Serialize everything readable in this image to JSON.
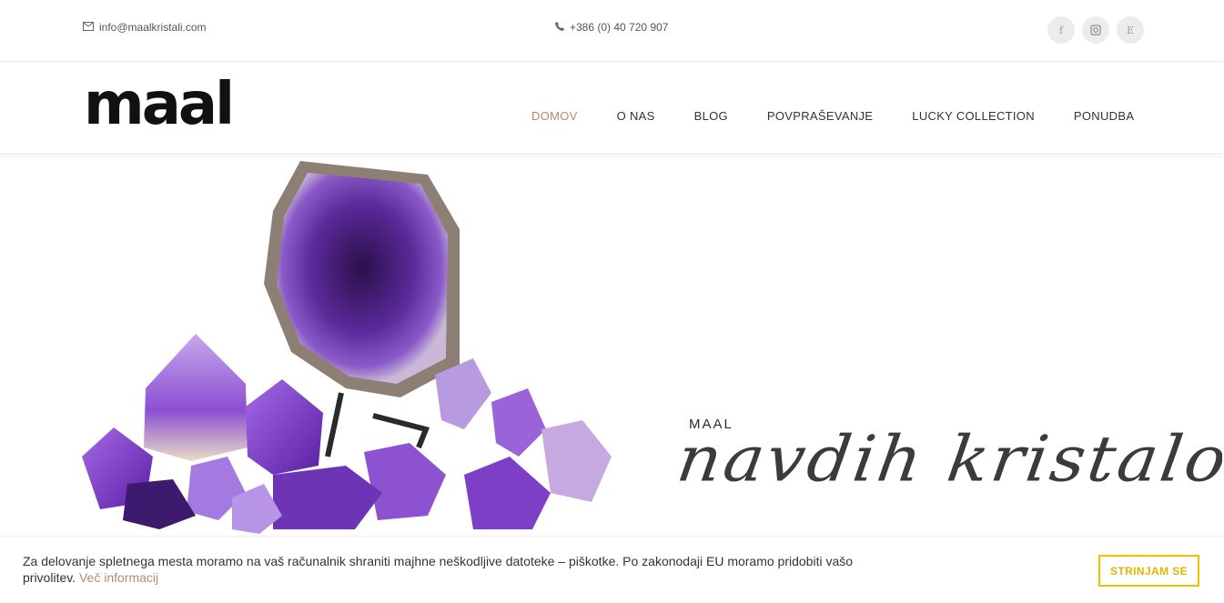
{
  "topbar": {
    "email": "info@maalkristali.com",
    "phone": "+386 (0) 40 720 907",
    "socials": [
      {
        "icon": "facebook-icon",
        "glyph": "f"
      },
      {
        "icon": "instagram-icon",
        "glyph": "◘"
      },
      {
        "icon": "etsy-icon",
        "glyph": "E"
      }
    ]
  },
  "header": {
    "logo": "maal",
    "nav": [
      "DOMOV",
      "O NAS",
      "BLOG",
      "POVPRAŠEVANJE",
      "LUCKY COLLECTION",
      "PONUDBA"
    ],
    "active_nav": "DOMOV",
    "accent_color": "#b9896d"
  },
  "hero": {
    "small_label": "MAAL",
    "script_text": "navdih kristalov"
  },
  "cookie": {
    "text": "Za delovanje spletnega mesta moramo na vaš računalnik shraniti majhne neškodljive datoteke – piškotke. Po zakonodaji EU moramo pridobiti vašo privolitev.",
    "link": "Več informacij",
    "button": "STRINJAM SE",
    "button_color": "#f2c200"
  }
}
